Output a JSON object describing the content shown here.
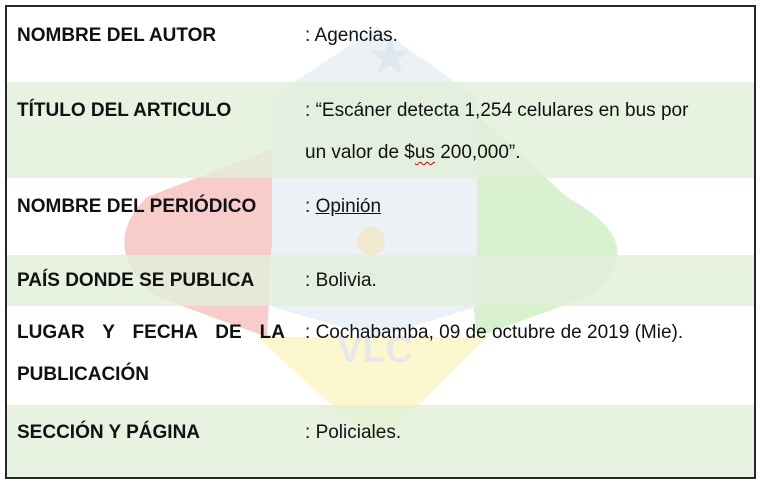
{
  "rows": [
    {
      "label": "NOMBRE DEL AUTOR",
      "separator": ":",
      "value": "Agencias."
    },
    {
      "label": "TÍTULO DEL ARTICULO",
      "separator": ":",
      "value_line1": "“Escáner detecta 1,254 celulares en bus por",
      "value_line2_pre": "un valor de $",
      "value_line2_wavy": "us",
      "value_line2_post": " 200,000”."
    },
    {
      "label": "NOMBRE DEL PERIÓDICO",
      "separator": ":",
      "value": "Opinión"
    },
    {
      "label": "PAÍS DONDE SE PUBLICA",
      "separator": ":",
      "value": "Bolivia."
    },
    {
      "label_line1": "LUGAR Y FECHA DE LA",
      "label_line2": "PUBLICACIÓN",
      "separator": ":",
      "value": "Cochabamba, 09 de octubre de 2019 (Mie)."
    },
    {
      "label": "SECCIÓN Y PÁGINA",
      "separator": ":",
      "value": "Policiales."
    }
  ],
  "watermark": {
    "text": "VLC"
  },
  "colors": {
    "row_shade": "#E2EFD9",
    "border": "#262626",
    "spell_underline": "#d00000"
  }
}
